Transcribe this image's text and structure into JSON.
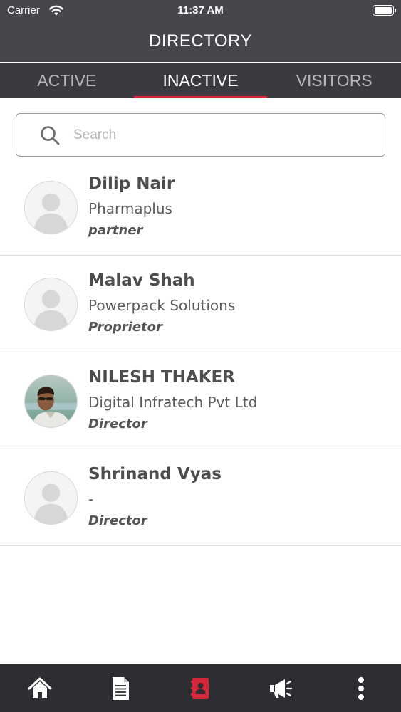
{
  "status_bar": {
    "carrier": "Carrier",
    "time": "11:37 AM"
  },
  "header": {
    "title": "DIRECTORY"
  },
  "tabs": [
    {
      "label": "ACTIVE",
      "active": false
    },
    {
      "label": "INACTIVE",
      "active": true
    },
    {
      "label": "VISITORS",
      "active": false
    }
  ],
  "search": {
    "placeholder": "Search",
    "value": ""
  },
  "contacts": [
    {
      "name": "Dilip Nair",
      "company": "Pharmaplus",
      "role": "partner",
      "avatar": "placeholder-avatar"
    },
    {
      "name": "Malav Shah",
      "company": "Powerpack Solutions",
      "role": "Proprietor",
      "avatar": "placeholder-avatar"
    },
    {
      "name": "NILESH THAKER",
      "company": "Digital Infratech Pvt Ltd",
      "role": "Director",
      "avatar": "photo-avatar"
    },
    {
      "name": "Shrinand Vyas",
      "company": "-",
      "role": "Director",
      "avatar": "placeholder-avatar"
    }
  ],
  "bottom_nav": [
    {
      "icon": "home-icon",
      "active": false
    },
    {
      "icon": "document-icon",
      "active": false
    },
    {
      "icon": "directory-icon",
      "active": true
    },
    {
      "icon": "megaphone-icon",
      "active": false
    },
    {
      "icon": "more-vertical-icon",
      "active": false
    }
  ],
  "colors": {
    "header_bg": "#46464b",
    "tab_bg": "#3a3a3f",
    "accent": "#d6263a",
    "nav_bg": "#2e2e32"
  }
}
